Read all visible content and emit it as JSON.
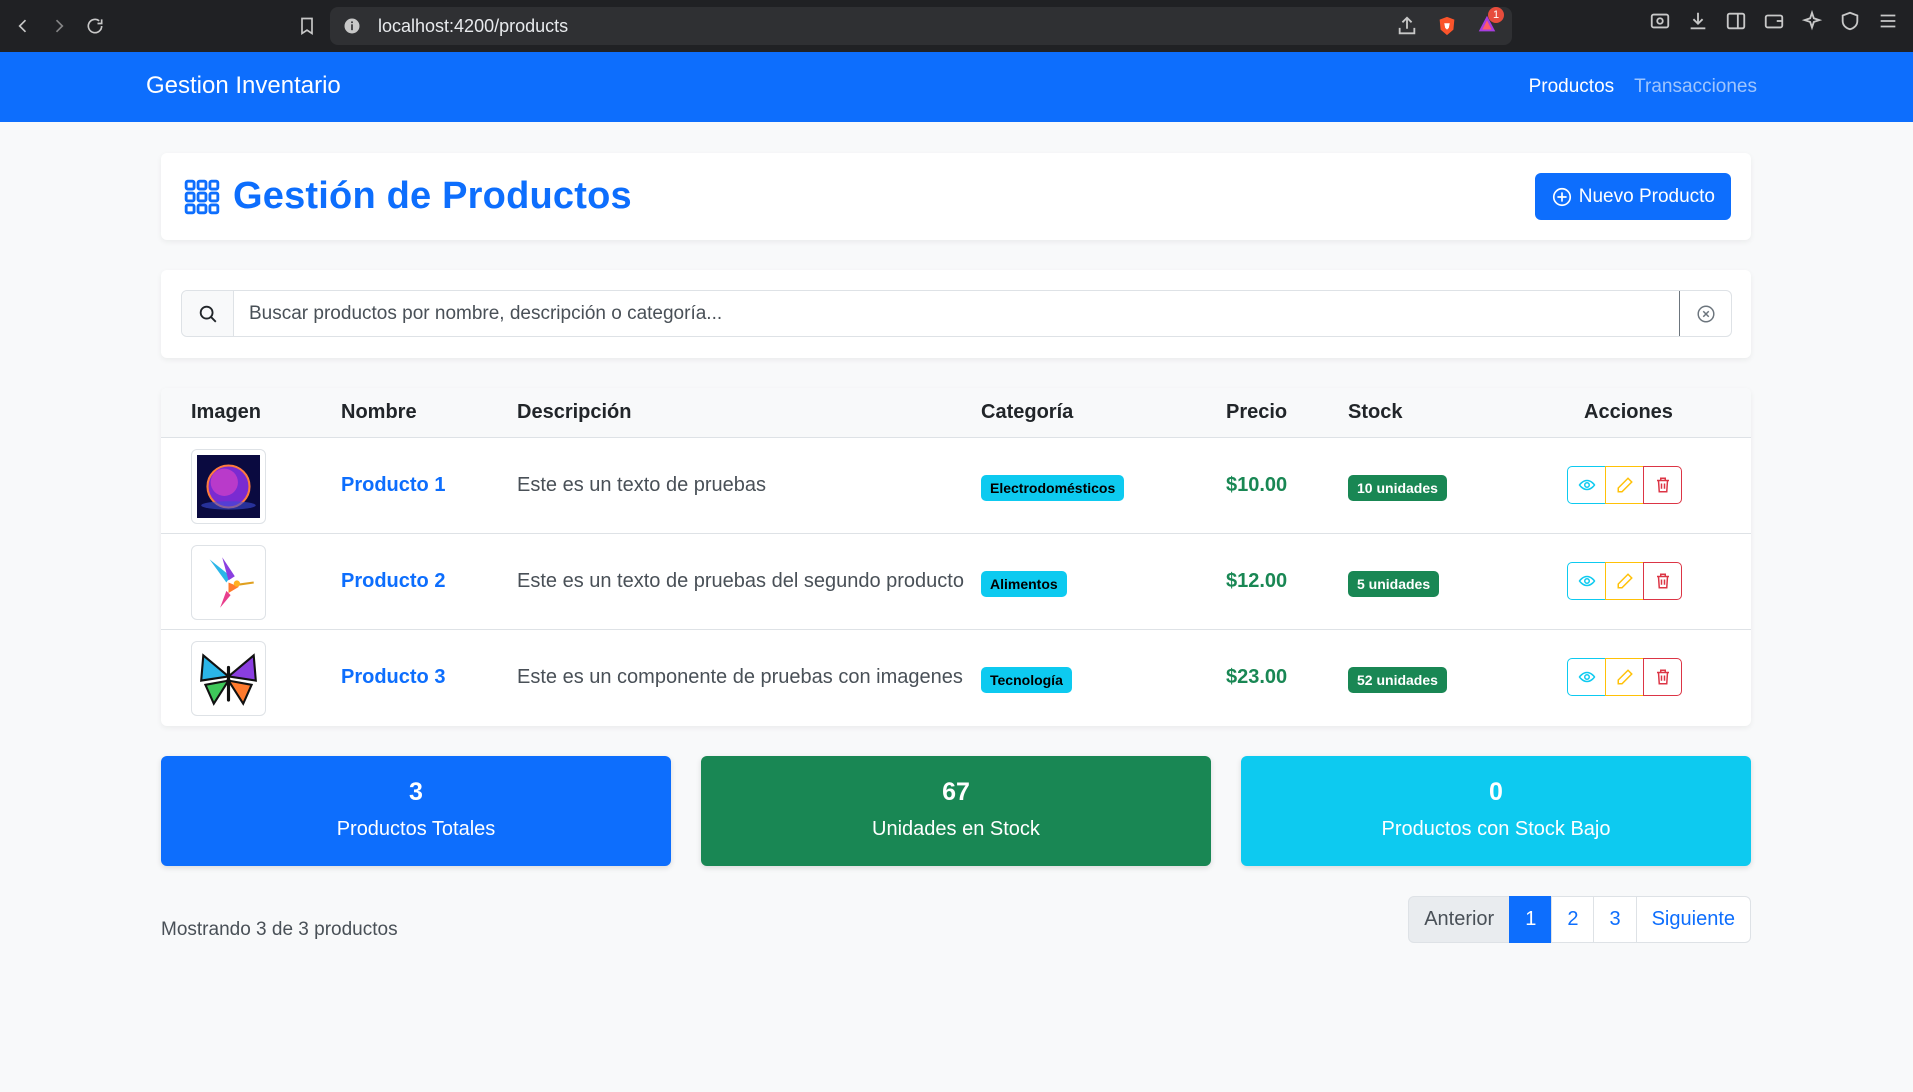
{
  "browser": {
    "url": "localhost:4200/products",
    "notification_count": "1"
  },
  "navbar": {
    "brand": "Gestion Inventario",
    "links": [
      {
        "label": "Productos",
        "active": true
      },
      {
        "label": "Transacciones",
        "active": false
      }
    ]
  },
  "header": {
    "title": "Gestión de Productos",
    "new_button": "Nuevo Producto"
  },
  "search": {
    "placeholder": "Buscar productos por nombre, descripción o categoría...",
    "value": ""
  },
  "table": {
    "columns": [
      "Imagen",
      "Nombre",
      "Descripción",
      "Categoría",
      "Precio",
      "Stock",
      "Acciones"
    ],
    "rows": [
      {
        "name": "Producto 1",
        "description": "Este es un texto de pruebas",
        "category": "Electrodomésticos",
        "price": "$10.00",
        "stock": "10 unidades",
        "image": "planet-image"
      },
      {
        "name": "Producto 2",
        "description": "Este es un texto de pruebas del segundo producto",
        "category": "Alimentos",
        "price": "$12.00",
        "stock": "5 unidades",
        "image": "hummingbird-image"
      },
      {
        "name": "Producto 3",
        "description": "Este es un componente de pruebas con imagenes",
        "category": "Tecnología",
        "price": "$23.00",
        "stock": "52 unidades",
        "image": "butterfly-image"
      }
    ]
  },
  "stats": [
    {
      "value": "3",
      "label": "Productos Totales",
      "color": "#0d6efd"
    },
    {
      "value": "67",
      "label": "Unidades en Stock",
      "color": "#198754"
    },
    {
      "value": "0",
      "label": "Productos con Stock Bajo",
      "color": "#0dcaf0"
    }
  ],
  "footer": {
    "showing": "Mostrando 3 de 3 productos"
  },
  "pagination": {
    "previous": "Anterior",
    "pages": [
      "1",
      "2",
      "3"
    ],
    "current": "1",
    "next": "Siguiente"
  },
  "colors": {
    "primary": "#0d6efd",
    "success": "#198754",
    "info": "#0dcaf0",
    "warning": "#ffc107",
    "danger": "#dc3545"
  }
}
